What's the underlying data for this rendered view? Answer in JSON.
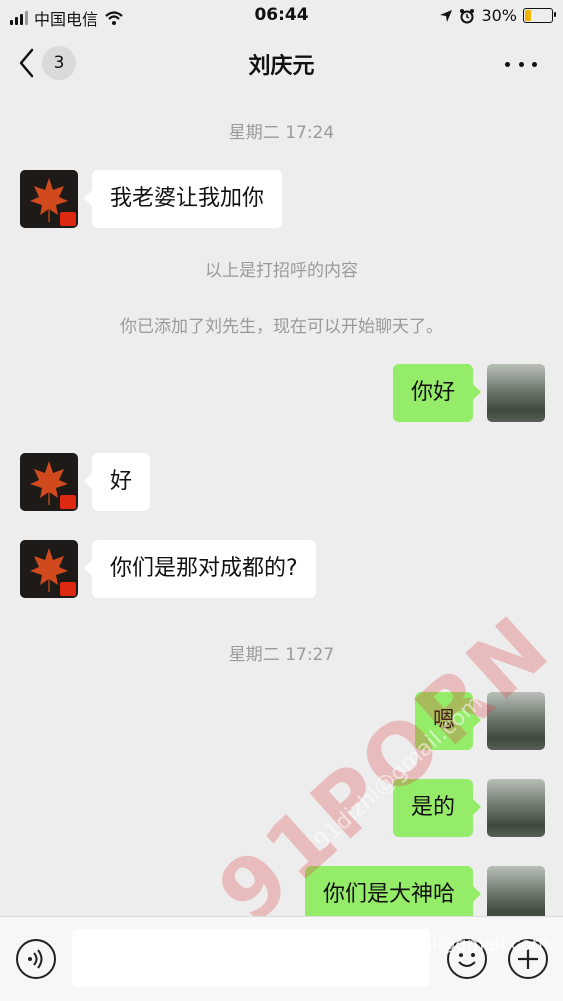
{
  "status": {
    "carrier": "中国电信",
    "time": "06:44",
    "battery": "30%",
    "battery_level": 0.3
  },
  "nav": {
    "badge": "3",
    "title": "刘庆元"
  },
  "timestamps": [
    "星期二 17:24",
    "星期二 17:27"
  ],
  "messages": [
    {
      "side": "left",
      "text": "我老婆让我加你"
    },
    {
      "side": "right",
      "text": "你好"
    },
    {
      "side": "left",
      "text": "好"
    },
    {
      "side": "left",
      "text": "你们是那对成都的?"
    },
    {
      "side": "right",
      "text": "嗯"
    },
    {
      "side": "right",
      "text": "是的"
    },
    {
      "side": "right",
      "text": "你们是大神哈"
    }
  ],
  "system": {
    "greeting_note": "以上是打招呼的内容",
    "added_note": "你已添加了刘先生，现在可以开始聊天了。"
  },
  "watermark": {
    "main": "91PORN",
    "email": "91dizhi@gmail.com",
    "bottom": "91dizhi@gmail.com"
  },
  "colors": {
    "bubble_green": "#95ec69",
    "bubble_white": "#ffffff",
    "background": "#ededed"
  }
}
